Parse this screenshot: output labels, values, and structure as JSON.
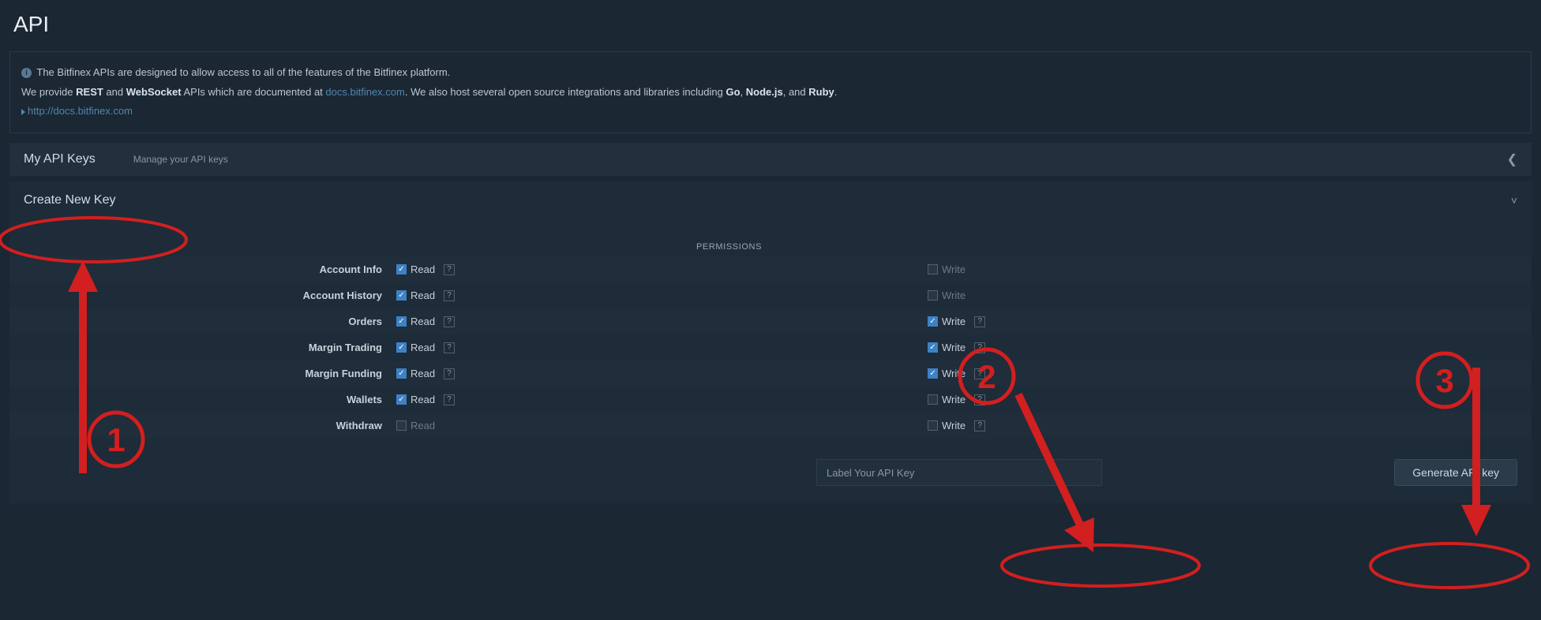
{
  "page": {
    "title": "API"
  },
  "info": {
    "line1": "The Bitfinex APIs are designed to allow access to all of the features of the Bitfinex platform.",
    "line2_pre": "We provide ",
    "rest": "REST",
    "and1": " and ",
    "ws": "WebSocket",
    "line2_mid": " APIs which are documented at ",
    "docs_link": "docs.bitfinex.com",
    "line2_post": ". We also host several open source integrations and libraries including ",
    "go": "Go",
    "comma1": ", ",
    "node": "Node.js",
    "comma2": ", and ",
    "ruby": "Ruby",
    "dot": ".",
    "full_link": "http://docs.bitfinex.com"
  },
  "myKeys": {
    "title": "My API Keys",
    "subtitle": "Manage your API keys"
  },
  "create": {
    "title": "Create New Key",
    "permissions_header": "PERMISSIONS",
    "read_label": "Read",
    "write_label": "Write",
    "label_placeholder": "Label Your API Key",
    "generate_label": "Generate API key",
    "rows": [
      {
        "label": "Account Info",
        "read_checked": true,
        "read_enabled": true,
        "read_help": true,
        "write_checked": false,
        "write_enabled": false,
        "write_help": false
      },
      {
        "label": "Account History",
        "read_checked": true,
        "read_enabled": true,
        "read_help": true,
        "write_checked": false,
        "write_enabled": false,
        "write_help": false
      },
      {
        "label": "Orders",
        "read_checked": true,
        "read_enabled": true,
        "read_help": true,
        "write_checked": true,
        "write_enabled": true,
        "write_help": true
      },
      {
        "label": "Margin Trading",
        "read_checked": true,
        "read_enabled": true,
        "read_help": true,
        "write_checked": true,
        "write_enabled": true,
        "write_help": true
      },
      {
        "label": "Margin Funding",
        "read_checked": true,
        "read_enabled": true,
        "read_help": true,
        "write_checked": true,
        "write_enabled": true,
        "write_help": true
      },
      {
        "label": "Wallets",
        "read_checked": true,
        "read_enabled": true,
        "read_help": true,
        "write_checked": false,
        "write_enabled": true,
        "write_help": true
      },
      {
        "label": "Withdraw",
        "read_checked": false,
        "read_enabled": false,
        "read_help": false,
        "write_checked": false,
        "write_enabled": true,
        "write_help": true
      }
    ]
  },
  "annotations": {
    "n1": "1",
    "n2": "2",
    "n3": "3"
  }
}
